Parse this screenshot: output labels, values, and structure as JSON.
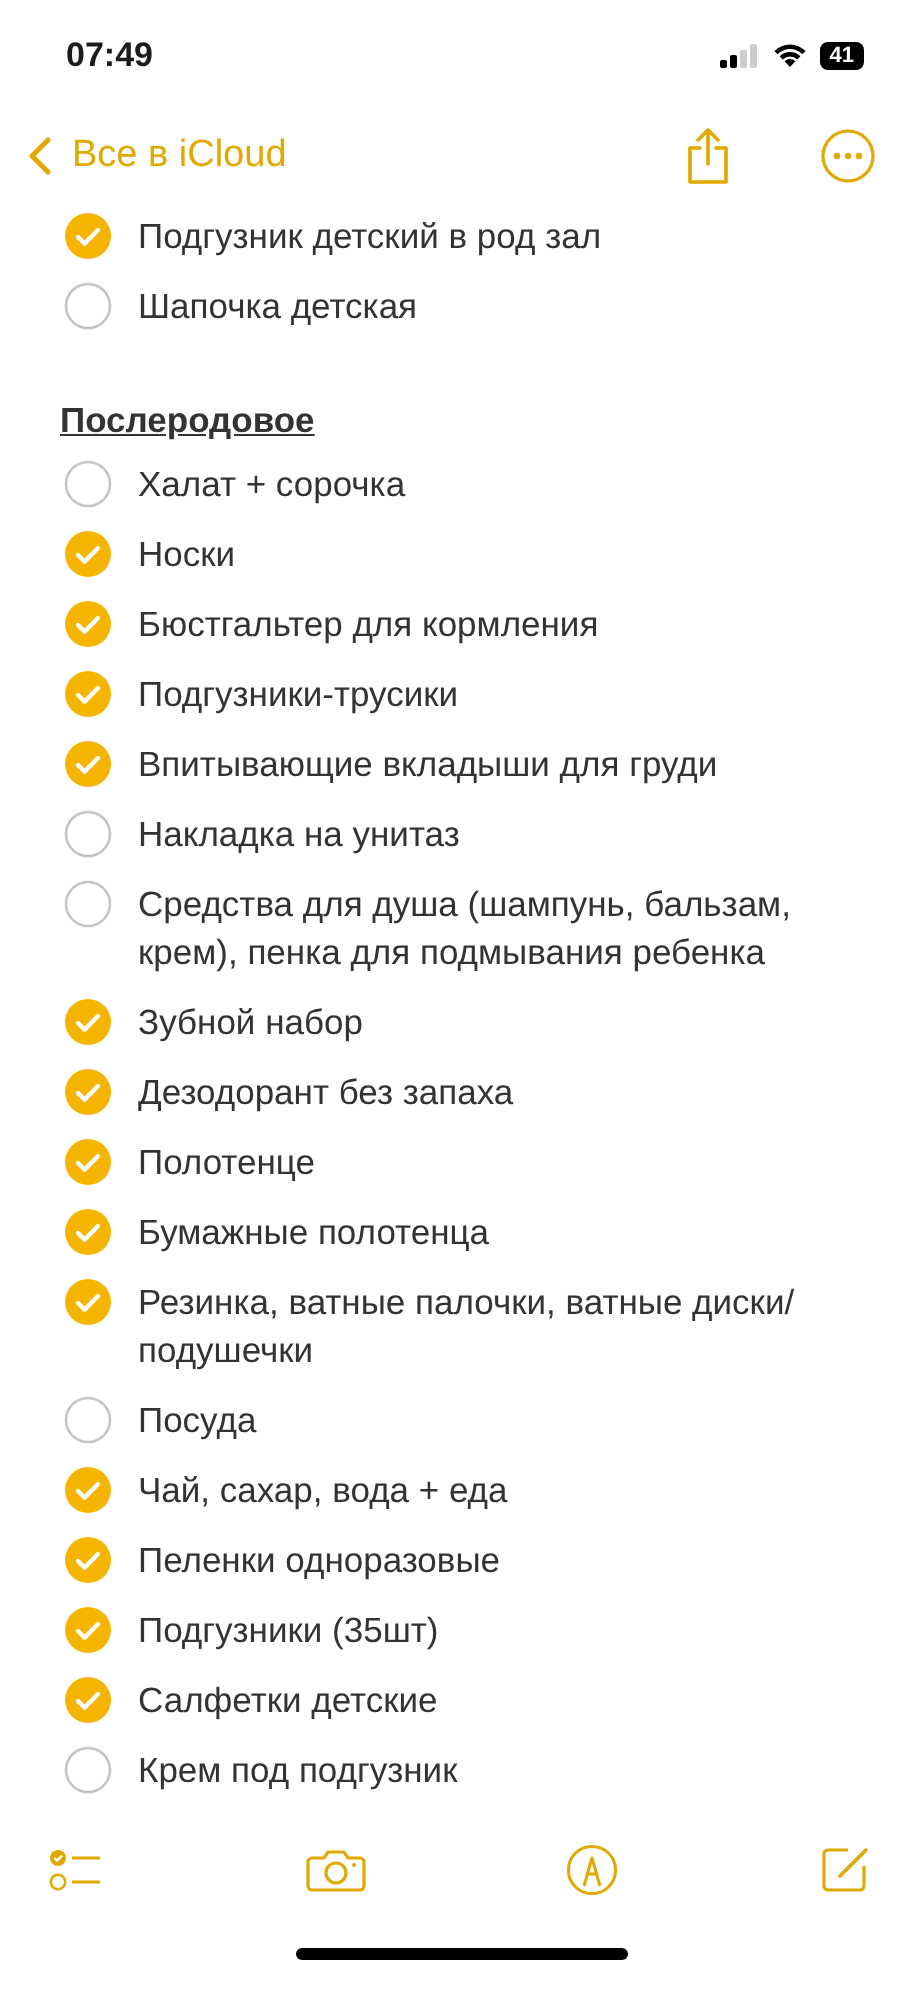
{
  "status_bar": {
    "time": "07:49",
    "battery": "41"
  },
  "nav": {
    "back_label": "Все в iCloud"
  },
  "items_top": [
    {
      "text": "Подгузник детский в род зал",
      "checked": true
    },
    {
      "text": "Шапочка детская",
      "checked": false
    }
  ],
  "section": {
    "title": "Послеродовое",
    "items": [
      {
        "text": "Халат + сорочка",
        "checked": false
      },
      {
        "text": "Носки",
        "checked": true
      },
      {
        "text": "Бюстгальтер для кормления",
        "checked": true
      },
      {
        "text": "Подгузники-трусики",
        "checked": true
      },
      {
        "text": "Впитывающие вкладыши для груди",
        "checked": true
      },
      {
        "text": "Накладка на унитаз",
        "checked": false
      },
      {
        "text": "Средства для душа (шампунь, бальзам, крем), пенка для подмывания ребенка",
        "checked": false
      },
      {
        "text": "Зубной набор",
        "checked": true
      },
      {
        "text": "Дезодорант без запаха",
        "checked": true
      },
      {
        "text": "Полотенце",
        "checked": true
      },
      {
        "text": "Бумажные полотенца",
        "checked": true
      },
      {
        "text": "Резинка, ватные палочки, ватные диски/подушечки",
        "checked": true
      },
      {
        "text": "Посуда",
        "checked": false
      },
      {
        "text": "Чай, сахар, вода + еда",
        "checked": true
      },
      {
        "text": "Пеленки одноразовые",
        "checked": true
      },
      {
        "text": "Подгузники (35шт)",
        "checked": true
      },
      {
        "text": "Салфетки детские",
        "checked": true
      },
      {
        "text": "Крем под подгузник",
        "checked": false
      }
    ]
  }
}
